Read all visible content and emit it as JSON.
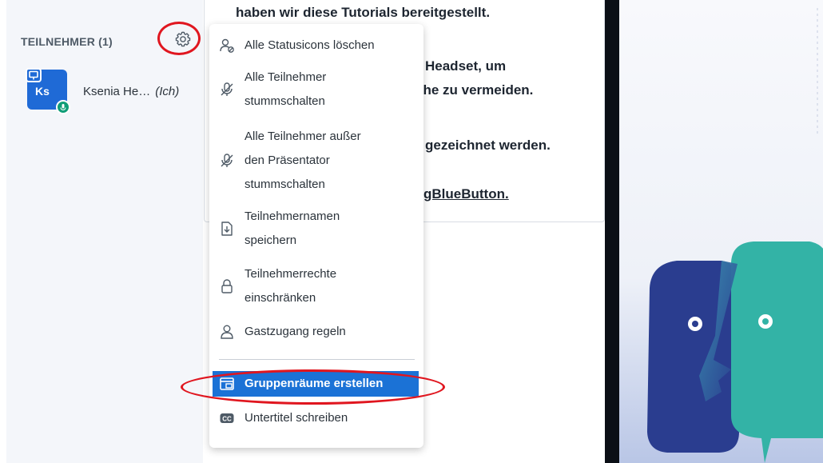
{
  "sidebar": {
    "participants_title": "TEILNEHMER (1)",
    "settings_icon": "gear-icon",
    "user": {
      "initials": "Ks",
      "name": "Ksenia He…",
      "you_label": "(Ich)",
      "avatar_color": "#1f6ad6",
      "status_color": "#0f9d77"
    }
  },
  "presentation": {
    "lines": [
      "haben wir diese Tutorials bereitgestellt.",
      "Headset, um",
      "che zu vermeiden.",
      "gezeichnet werden.",
      "gBlueButton"
    ],
    "line5_suffix": "."
  },
  "menu": {
    "items": [
      {
        "label": "Alle Statusicons löschen",
        "icon": "user-clear-icon"
      },
      {
        "label": "Alle Teilnehmer\nstummschalten",
        "icon": "mute-icon"
      },
      {
        "label": "Alle Teilnehmer außer\nden Präsentator\nstummschalten",
        "icon": "mute-icon"
      },
      {
        "label": "Teilnehmernamen\nspeichern",
        "icon": "download-file-icon"
      },
      {
        "label": "Teilnehmerrechte\neinschränken",
        "icon": "lock-icon"
      },
      {
        "label": "Gastzugang regeln",
        "icon": "user-icon"
      },
      {
        "label": "Gruppenräume erstellen",
        "icon": "rooms-icon"
      },
      {
        "label": "Untertitel schreiben",
        "icon": "cc-icon"
      }
    ]
  },
  "colors": {
    "accent": "#1b72d6",
    "highlight_ring": "#e0161f",
    "slide_dark": "#2a3d8f",
    "slide_teal": "#33b3a6"
  }
}
